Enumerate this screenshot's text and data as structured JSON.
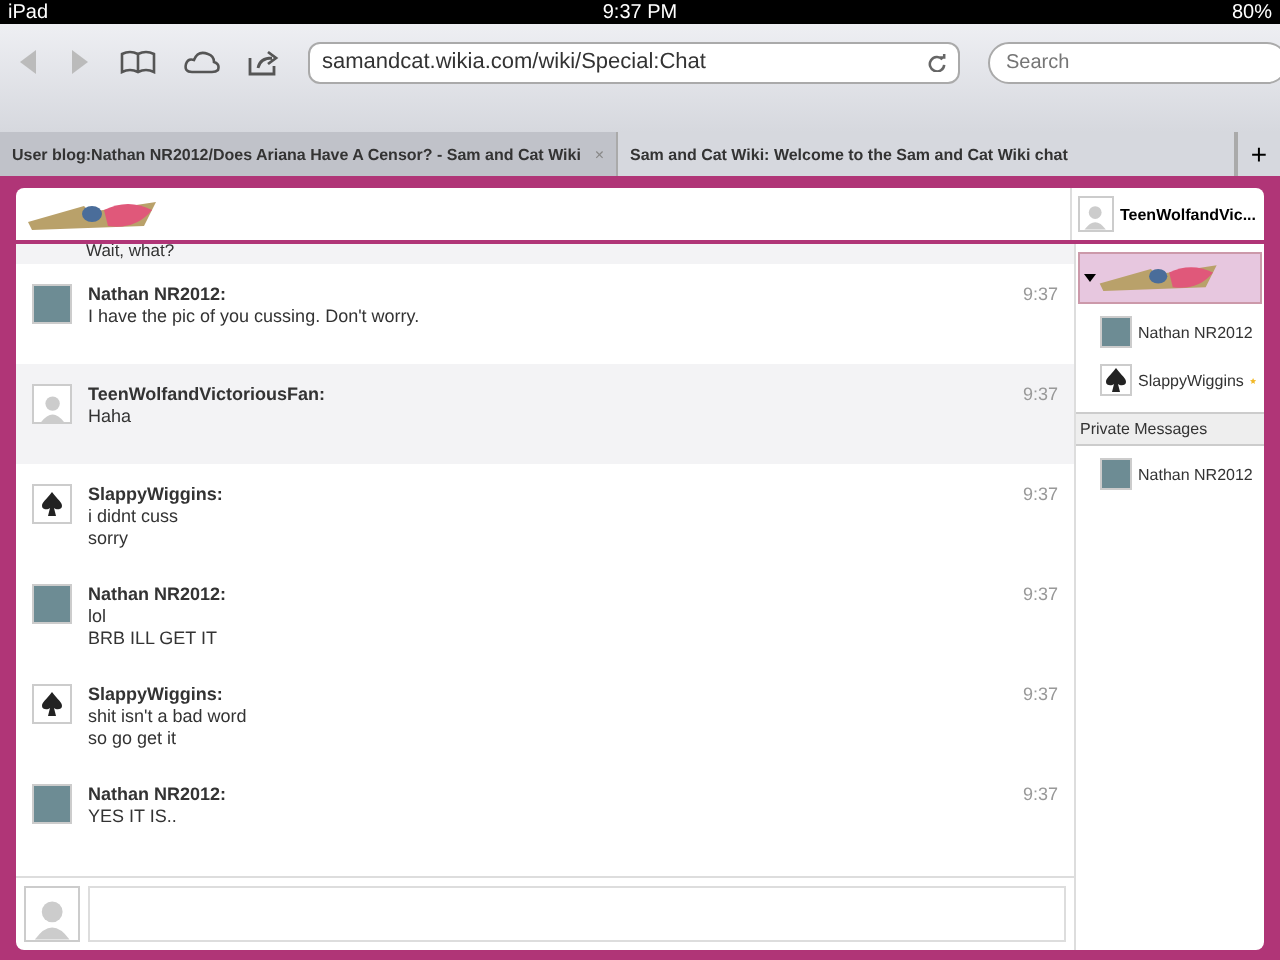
{
  "status_bar": {
    "device": "iPad",
    "time": "9:37 PM",
    "battery": "80%"
  },
  "browser": {
    "url": "samandcat.wikia.com/wiki/Special:Chat",
    "search": {
      "placeholder": "Search"
    },
    "tabs": [
      {
        "label": "User blog:Nathan NR2012/Does Ariana Have A Censor? - Sam and Cat Wiki",
        "selected": false,
        "close": "×"
      },
      {
        "label": "Sam and Cat Wiki: Welcome to the Sam and Cat Wiki chat",
        "selected": true
      }
    ],
    "new_tab": "+"
  },
  "chat": {
    "current_user": "TeenWolfandVic...",
    "partial_message": "Wait, what?",
    "messages": [
      {
        "user": "Nathan NR2012:",
        "kind": "photo",
        "time": "9:37",
        "lines": [
          "I have the pic of you cussing. Don't worry."
        ],
        "highlighted": false
      },
      {
        "user": "TeenWolfandVictoriousFan:",
        "kind": "default",
        "time": "9:37",
        "lines": [
          "Haha"
        ],
        "highlighted": true
      },
      {
        "user": "SlappyWiggins:",
        "kind": "spade",
        "time": "9:37",
        "lines": [
          "i didnt cuss",
          "sorry"
        ],
        "highlighted": false
      },
      {
        "user": "Nathan NR2012:",
        "kind": "photo",
        "time": "9:37",
        "lines": [
          "lol",
          "BRB ILL GET IT"
        ],
        "highlighted": false
      },
      {
        "user": "SlappyWiggins:",
        "kind": "spade",
        "time": "9:37",
        "lines": [
          "shit isn't a bad word",
          "so go get it"
        ],
        "highlighted": false
      },
      {
        "user": "Nathan NR2012:",
        "kind": "photo",
        "time": "9:37",
        "lines": [
          "YES IT IS.."
        ],
        "highlighted": false
      }
    ],
    "users": [
      {
        "name": "Nathan NR2012",
        "kind": "photo",
        "starred": false
      },
      {
        "name": "SlappyWiggins",
        "kind": "spade",
        "starred": true
      }
    ],
    "private_heading": "Private Messages",
    "private": [
      {
        "name": "Nathan NR2012",
        "kind": "photo"
      }
    ]
  }
}
